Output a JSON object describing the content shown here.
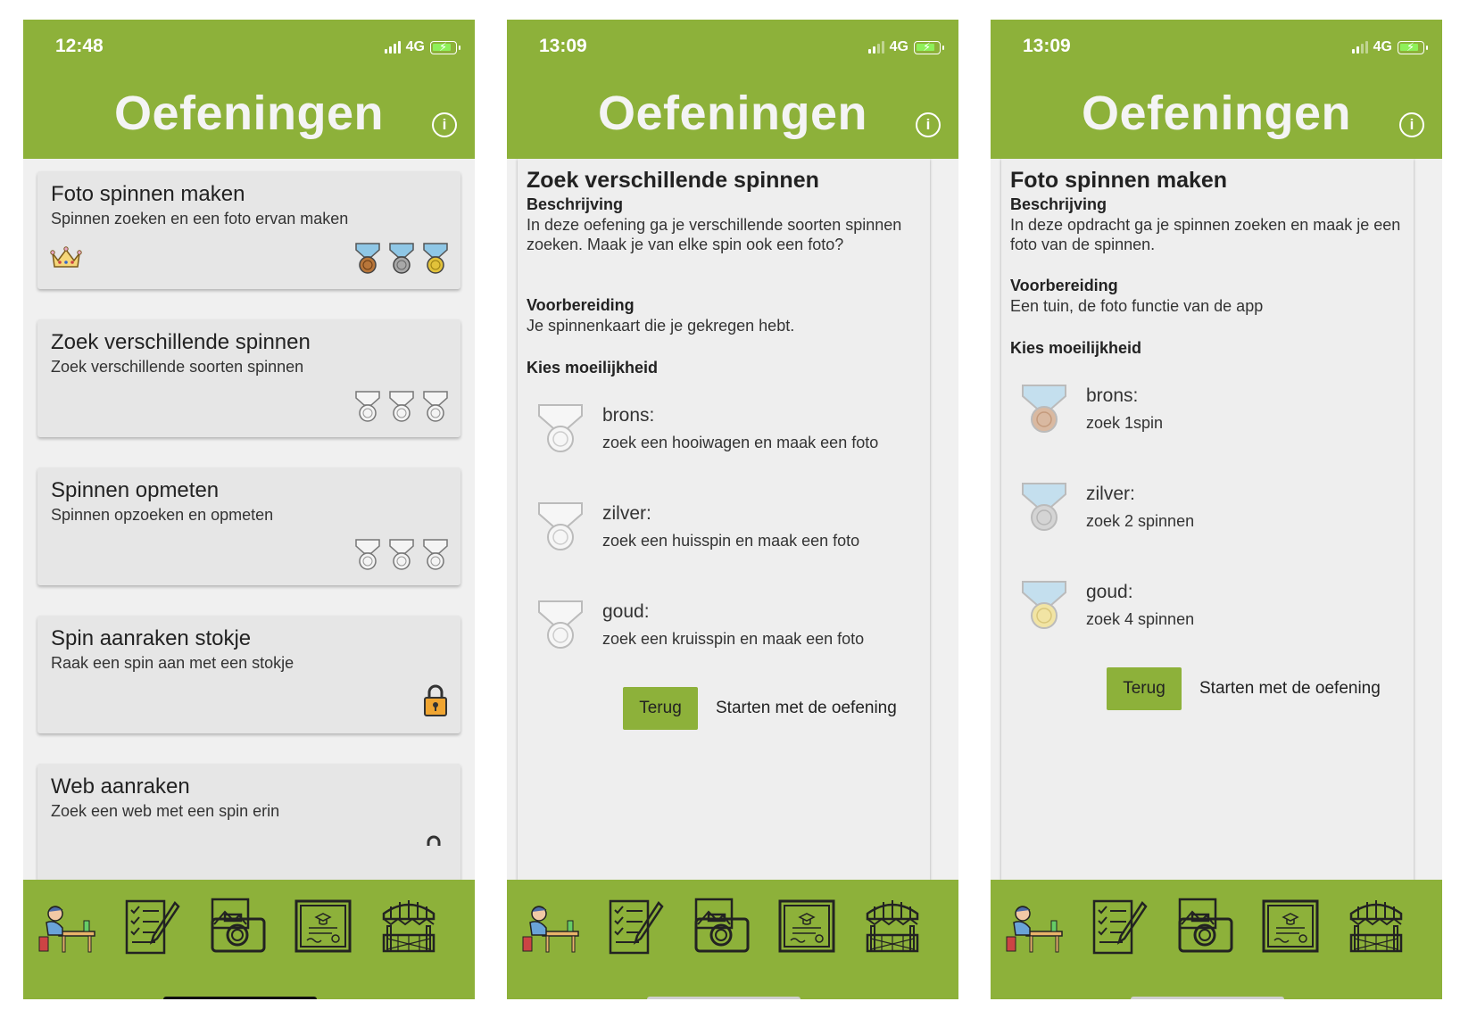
{
  "phones": [
    {
      "time": "12:48",
      "network": "4G",
      "title": "Oefeningen",
      "exercises": [
        {
          "title": "Foto spinnen maken",
          "subtitle": "Spinnen zoeken en een foto ervan maken"
        },
        {
          "title": "Zoek verschillende spinnen",
          "subtitle": "Zoek verschillende soorten spinnen"
        },
        {
          "title": "Spinnen opmeten",
          "subtitle": "Spinnen opzoeken en opmeten"
        },
        {
          "title": "Spin aanraken stokje",
          "subtitle": "Raak een spin aan met een stokje"
        },
        {
          "title": "Web aanraken",
          "subtitle": "Zoek een web met een spin erin"
        }
      ]
    },
    {
      "time": "13:09",
      "network": "4G",
      "title": "Oefeningen",
      "detail": {
        "title": "Zoek verschillende spinnen",
        "description_heading": "Beschrijving",
        "description": "In deze oefening ga je verschillende soorten spinnen zoeken. Maak je van elke spin ook een foto?",
        "preparation_heading": "Voorbereiding",
        "preparation": "Je spinnenkaart die je gekregen hebt.",
        "difficulty_heading": "Kies moeilijkheid",
        "levels": [
          {
            "name": "brons:",
            "description": "zoek een hooiwagen en maak een foto"
          },
          {
            "name": "zilver:",
            "description": "zoek een huisspin en maak een foto"
          },
          {
            "name": "goud:",
            "description": "zoek een kruisspin en maak een foto"
          }
        ],
        "back_label": "Terug",
        "start_label": "Starten met de oefening"
      }
    },
    {
      "time": "13:09",
      "network": "4G",
      "title": "Oefeningen",
      "detail": {
        "title": "Foto spinnen maken",
        "description_heading": "Beschrijving",
        "description": "In deze opdracht ga je spinnen zoeken en maak je een foto van de spinnen.",
        "preparation_heading": "Voorbereiding",
        "preparation": "Een tuin, de foto functie van de app",
        "difficulty_heading": "Kies moeilijkheid",
        "levels": [
          {
            "name": "brons:",
            "description": "zoek 1spin"
          },
          {
            "name": "zilver:",
            "description": "zoek 2 spinnen"
          },
          {
            "name": "goud:",
            "description": "zoek 4 spinnen"
          }
        ],
        "back_label": "Terug",
        "start_label": "Starten met de oefening"
      }
    }
  ],
  "colors": {
    "brand_green": "#8db13a",
    "bronze": "#b8763a",
    "silver": "#9e9e9e",
    "gold": "#e2c23a"
  },
  "icons": {
    "nav": [
      "student-desk-icon",
      "checklist-pencil-icon",
      "camera-photo-icon",
      "certificate-icon",
      "market-stall-icon"
    ],
    "exercise_status": [
      "crown-icon",
      "medal-icon",
      "lock-icon"
    ]
  }
}
